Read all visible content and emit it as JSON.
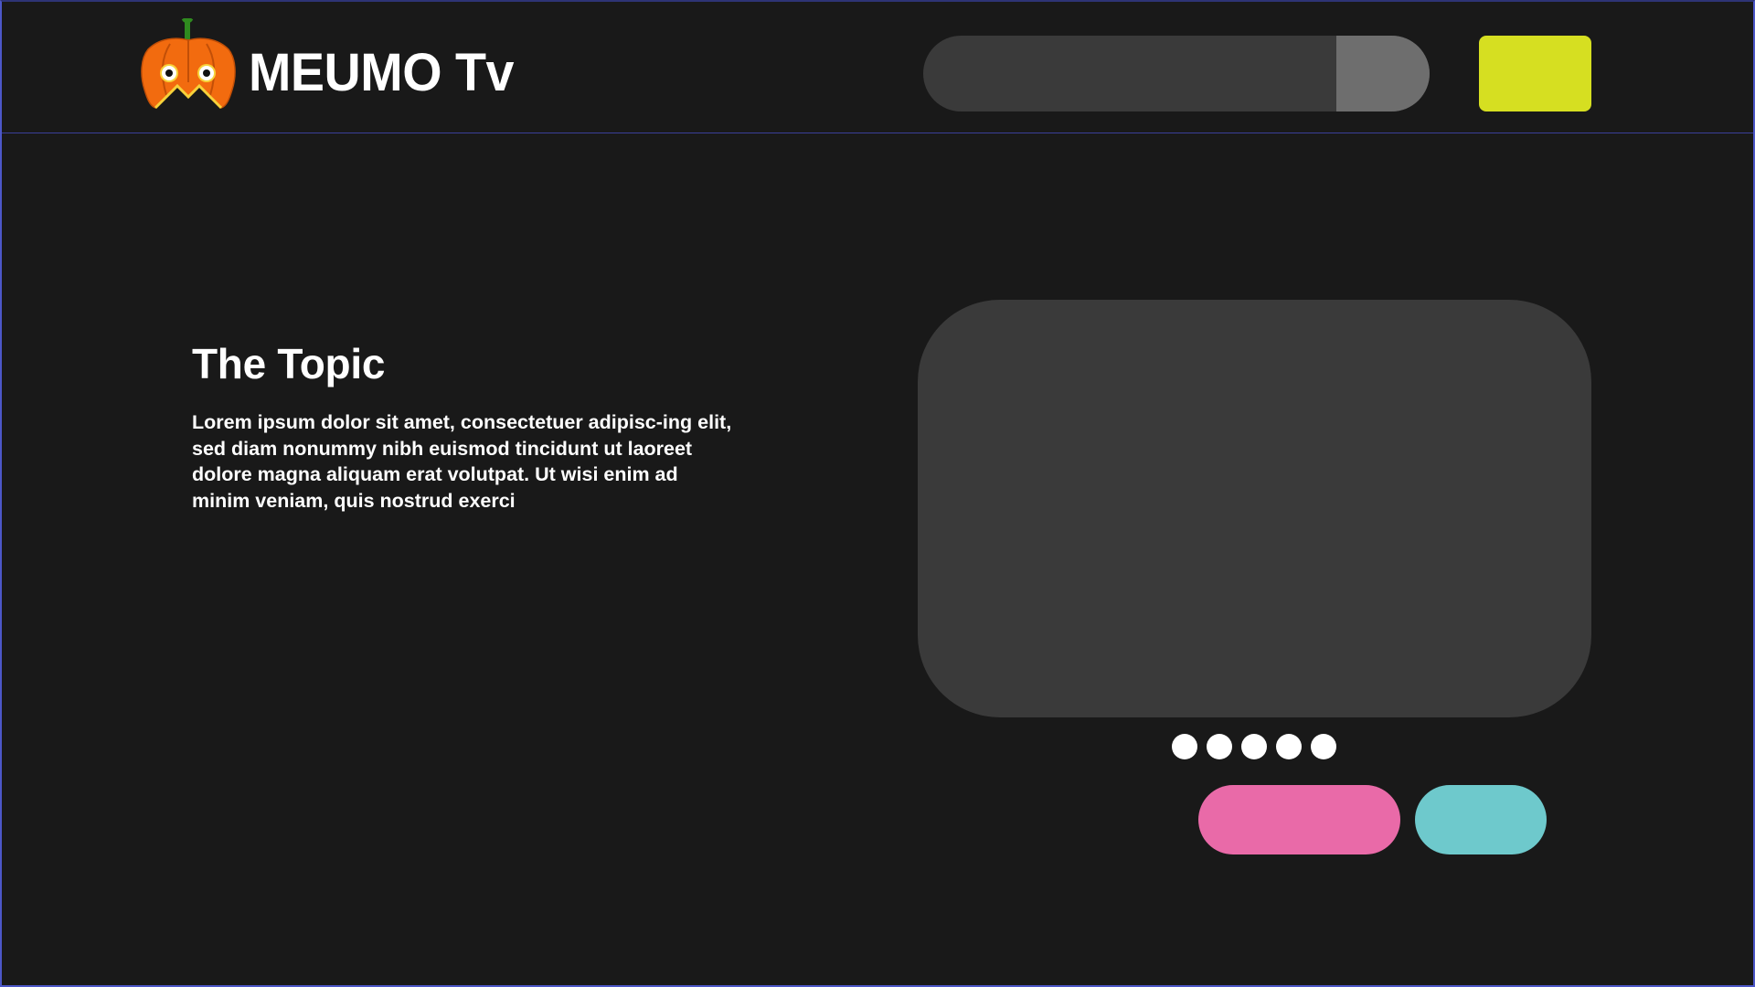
{
  "header": {
    "brand": "MEUMO Tv",
    "logo_icon": "pumpkin-mascot-icon",
    "search": {
      "placeholder": "",
      "button_icon": "search-icon",
      "button_color": "#6e6e6e"
    },
    "action_button_color": "#d6df21"
  },
  "main": {
    "topic_title": "The Topic",
    "topic_body": "Lorem ipsum dolor sit amet, consectetuer adipisc-ing elit, sed diam nonummy nibh euismod tincidunt ut laoreet dolore magna aliquam erat volutpat. Ut wisi enim ad minim veniam, quis nostrud exerci",
    "carousel": {
      "slide_count": 5
    },
    "buttons": [
      {
        "color": "#e96aa8"
      },
      {
        "color": "#6ec9cc"
      }
    ]
  },
  "colors": {
    "background": "#191919",
    "panel": "#3a3a3a",
    "border": "#4c57c7",
    "text": "#ffffff",
    "logo_orange": "#f26b0f"
  }
}
